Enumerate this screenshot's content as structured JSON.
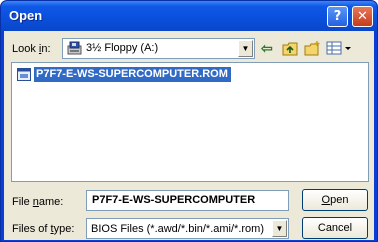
{
  "window": {
    "title": "Open",
    "help_label": "?",
    "close_label": "✕"
  },
  "look_in": {
    "label_prefix": "Look ",
    "label_accel": "i",
    "label_suffix": "n:",
    "value": "3½ Floppy (A:)"
  },
  "toolbar": {
    "back_icon": "back-arrow-icon",
    "up_icon": "up-one-level-icon",
    "new_folder_icon": "new-folder-icon",
    "views_icon": "views-menu-icon"
  },
  "files": [
    {
      "name": "P7F7-E-WS-SUPERCOMPUTER.ROM",
      "selected": true
    }
  ],
  "file_name": {
    "label_prefix": "File ",
    "label_accel": "n",
    "label_suffix": "ame:",
    "value": "P7F7-E-WS-SUPERCOMPUTER"
  },
  "file_type": {
    "label_prefix": "Files of ",
    "label_accel": "t",
    "label_suffix": "ype:",
    "value": "BIOS Files (*.awd/*.bin/*.ami/*.rom)"
  },
  "buttons": {
    "open_accel": "O",
    "open_rest": "pen",
    "cancel": "Cancel"
  },
  "colors": {
    "titlebar": "#0a4fdc",
    "selection": "#316ac5",
    "dialog_face": "#ece9d8"
  }
}
